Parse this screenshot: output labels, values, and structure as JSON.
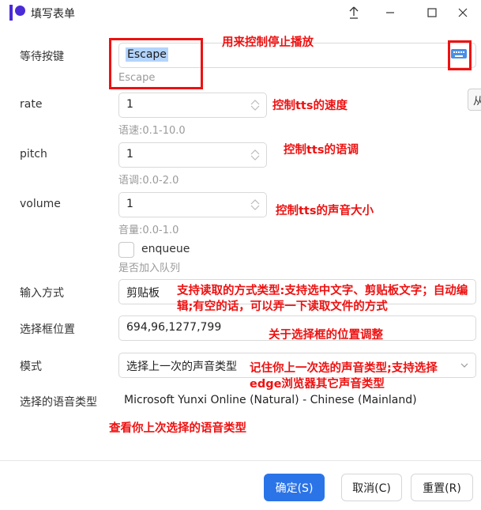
{
  "window": {
    "title": "填写表单",
    "controls": [
      "pin-icon",
      "minimize-icon",
      "maximize-icon",
      "close-icon"
    ]
  },
  "form": {
    "hotkey": {
      "label": "等待按键",
      "value": "Escape",
      "hint": "Escape",
      "icon": "keyboard-icon"
    },
    "rate": {
      "label": "rate",
      "value": "1",
      "hint": "语速:0.1-10.0"
    },
    "pitch": {
      "label": "pitch",
      "value": "1",
      "hint": "语调:0.0-2.0"
    },
    "volume": {
      "label": "volume",
      "value": "1",
      "hint": "音量:0.0-1.0"
    },
    "enqueue": {
      "label": "enqueue",
      "hint": "是否加入队列",
      "checked": false
    },
    "input_mode": {
      "label": "输入方式",
      "value": "剪贴板"
    },
    "box_position": {
      "label": "选择框位置",
      "value": "694,96,1277,799"
    },
    "mode": {
      "label": "模式",
      "value": "选择上一次的声音类型"
    },
    "voice": {
      "label": "选择的语音类型",
      "value": "Microsoft Yunxi Online (Natural) - Chinese (Mainland)"
    }
  },
  "side_tab": {
    "label": "从"
  },
  "buttons": {
    "ok": "确定(S)",
    "cancel": "取消(C)",
    "reset": "重置(R)"
  },
  "annotations": {
    "hotkey": "用来控制停止播放",
    "rate": "控制tts的速度",
    "pitch": "控制tts的语调",
    "volume": "控制tts的声音大小",
    "input_mode": "支持读取的方式类型:支持选中文字、剪贴板文字；自动编辑;有空的话，可以弄一下读取文件的方式",
    "box_position": "关于选择框的位置调整",
    "mode": "记住你上一次选的声音类型;支持选择edge浏览器其它声音类型",
    "voice": "查看你上次选择的语音类型"
  },
  "colors": {
    "accent": "#2b74e8",
    "annotation": "#ee1111",
    "logo": "#4a2bd6",
    "selection": "#b3d4fc"
  }
}
